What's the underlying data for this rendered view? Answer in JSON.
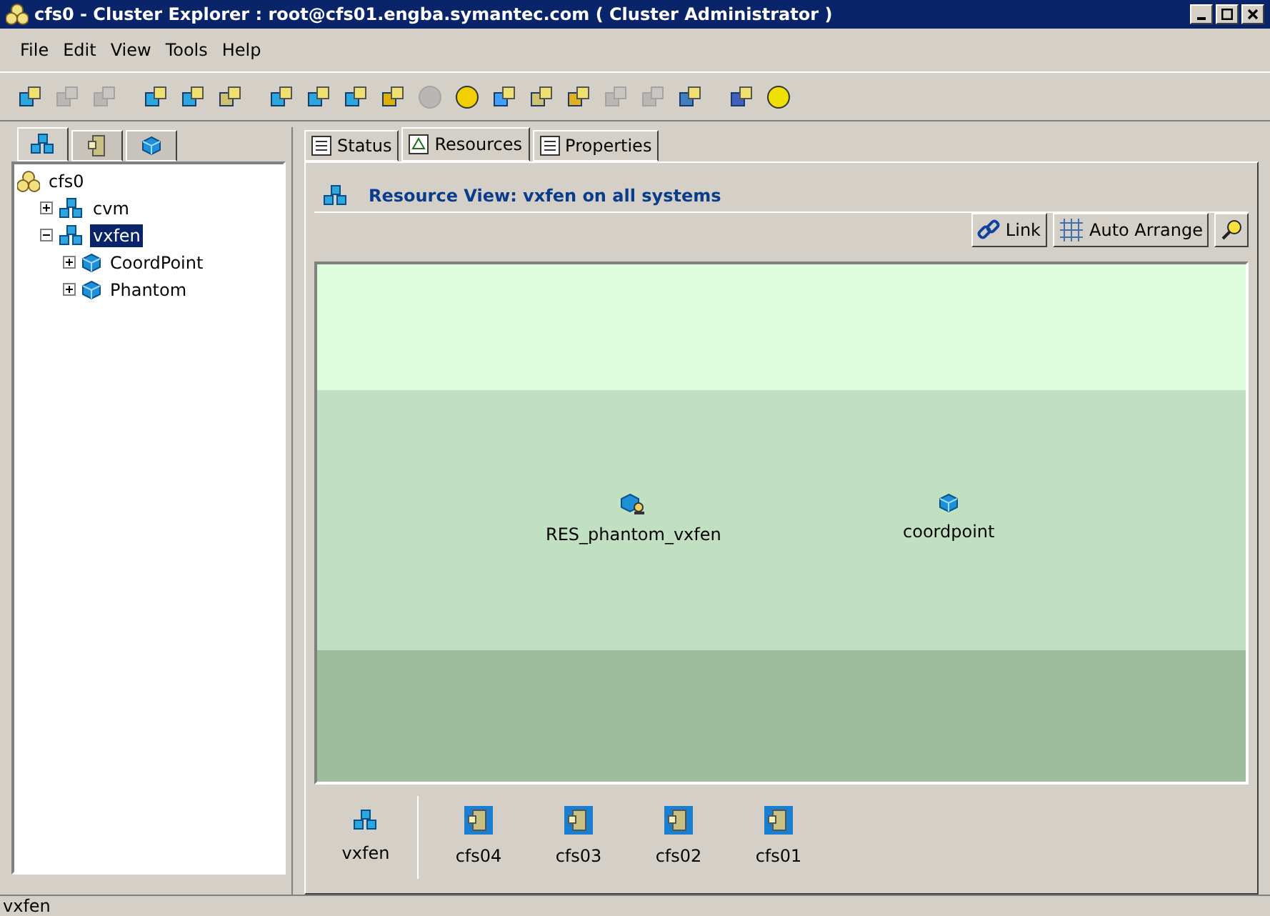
{
  "window": {
    "title": "cfs0 - Cluster Explorer : root@cfs01.engba.symantec.com ( Cluster Administrator )"
  },
  "menu": [
    "File",
    "Edit",
    "View",
    "Tools",
    "Help"
  ],
  "toolbar": [
    {
      "disabled": false
    },
    {
      "disabled": true
    },
    {
      "disabled": true
    },
    {
      "disabled": false
    },
    {
      "disabled": false
    },
    {
      "disabled": false
    },
    {
      "disabled": false
    },
    {
      "disabled": false
    },
    {
      "disabled": false
    },
    {
      "disabled": false
    },
    {
      "disabled": true
    },
    {
      "disabled": false
    },
    {
      "disabled": false
    },
    {
      "disabled": false
    },
    {
      "disabled": false
    },
    {
      "disabled": true
    },
    {
      "disabled": true
    },
    {
      "disabled": false
    },
    {
      "disabled": false
    },
    {
      "disabled": false
    }
  ],
  "left_tabs": [
    {
      "selected": true
    },
    {
      "selected": false
    },
    {
      "selected": false
    }
  ],
  "tree": [
    {
      "label": "cfs0",
      "kind": "cluster",
      "selected": false,
      "children": [
        {
          "label": "cvm",
          "kind": "group",
          "expanded": false,
          "selected": false
        },
        {
          "label": "vxfen",
          "kind": "group",
          "expanded": true,
          "selected": true,
          "children": [
            {
              "label": "CoordPoint",
              "kind": "type",
              "expanded": false,
              "selected": false
            },
            {
              "label": "Phantom",
              "kind": "type",
              "expanded": false,
              "selected": false
            }
          ]
        }
      ]
    }
  ],
  "tabs": [
    {
      "label": "Status",
      "selected": false
    },
    {
      "label": "Resources",
      "selected": true
    },
    {
      "label": "Properties",
      "selected": false
    }
  ],
  "view_title": "Resource View: vxfen on all systems",
  "view_buttons": [
    {
      "label": "Link",
      "kind": "link"
    },
    {
      "label": "Auto Arrange",
      "kind": "arrange"
    },
    {
      "kind": "zoom"
    }
  ],
  "resources": [
    {
      "label": "RES_phantom_vxfen",
      "kind": "phantom"
    },
    {
      "label": "coordpoint",
      "kind": "coordpoint"
    }
  ],
  "group": {
    "label": "vxfen"
  },
  "systems": [
    "cfs04",
    "cfs03",
    "cfs02",
    "cfs01"
  ],
  "status_bar": "vxfen"
}
